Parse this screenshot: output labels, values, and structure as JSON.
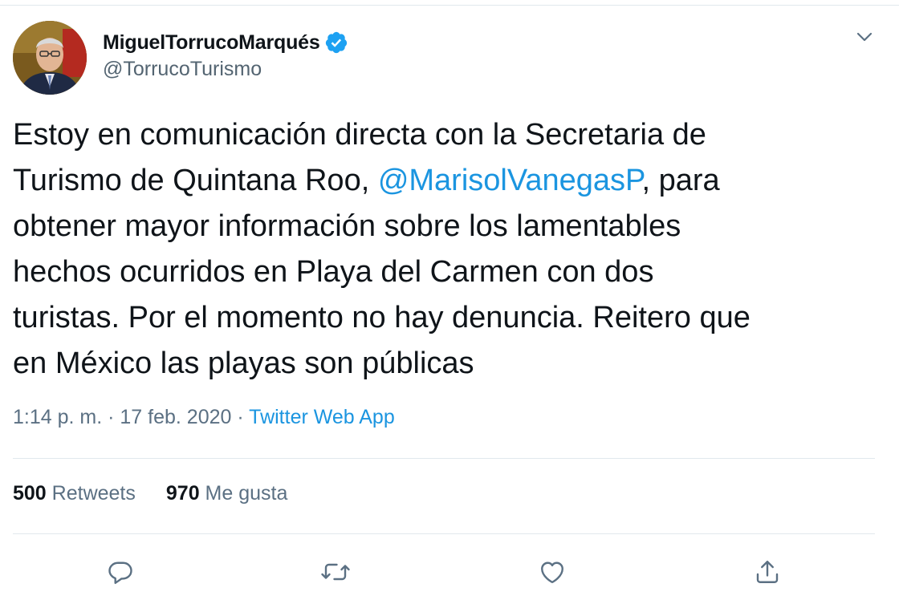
{
  "tweet": {
    "author": {
      "display_name": "MiguelTorrucoMarqués",
      "handle": "@TorrucoTurismo",
      "verified": true,
      "avatar_icon": "profile-photo"
    },
    "text_lines": [
      {
        "before": "Estoy en comunicación directa con la Secretaria de",
        "mention": "",
        "after": ""
      },
      {
        "before": "Turismo de Quintana Roo, ",
        "mention": "@MarisolVanegasP",
        "after": ", para"
      },
      {
        "before": "obtener mayor información sobre los lamentables",
        "mention": "",
        "after": ""
      },
      {
        "before": "hechos ocurridos en Playa del Carmen con dos",
        "mention": "",
        "after": ""
      },
      {
        "before": "turistas. Por el momento no hay denuncia. Reitero que",
        "mention": "",
        "after": ""
      },
      {
        "before": "en México las playas son públicas",
        "mention": "",
        "after": ""
      }
    ],
    "time": "1:14 p. m.",
    "separator": " · ",
    "date": "17 feb. 2020",
    "source": "Twitter Web App",
    "stats": {
      "retweets_count": "500",
      "retweets_label": " Retweets",
      "likes_count": "970",
      "likes_label": " Me gusta"
    },
    "actions": [
      {
        "name": "reply",
        "icon": "reply-icon"
      },
      {
        "name": "retweet",
        "icon": "retweet-icon"
      },
      {
        "name": "like",
        "icon": "heart-icon"
      },
      {
        "name": "share",
        "icon": "share-icon"
      }
    ]
  },
  "colors": {
    "text": "#0f1419",
    "secondary": "#5b7083",
    "link": "#1b95e0",
    "divider": "#e1e8ed",
    "verified": "#1da1f2"
  }
}
